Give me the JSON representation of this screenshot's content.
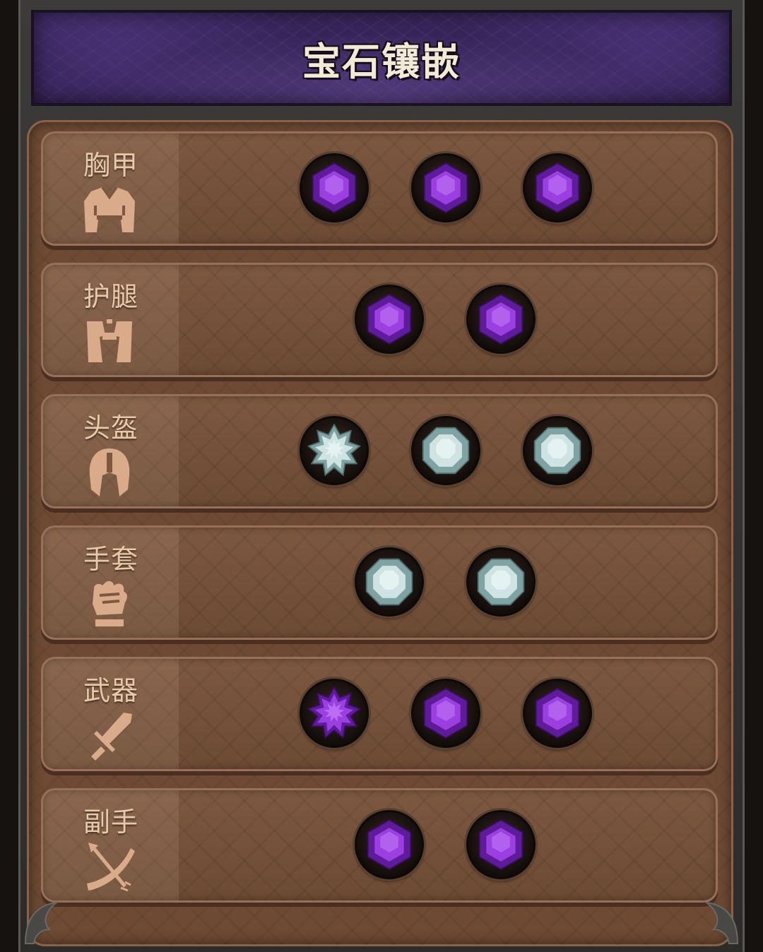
{
  "header": {
    "title": "宝石镶嵌"
  },
  "colors": {
    "purple_gem": "#9b3fe0",
    "silver_gem": "#cfe3e2",
    "label_text": "#e8c9a8",
    "panel_brown": "#6e4a34"
  },
  "slots": [
    {
      "label": "胸甲",
      "icon": "chest-armor-icon",
      "gems": [
        "purple-hexagon",
        "purple-hexagon",
        "purple-hexagon"
      ]
    },
    {
      "label": "护腿",
      "icon": "leg-armor-icon",
      "gems": [
        "purple-hexagon",
        "purple-hexagon"
      ]
    },
    {
      "label": "头盔",
      "icon": "helmet-icon",
      "gems": [
        "silver-star",
        "silver-octagon",
        "silver-octagon"
      ]
    },
    {
      "label": "手套",
      "icon": "glove-fist-icon",
      "gems": [
        "silver-octagon",
        "silver-octagon"
      ]
    },
    {
      "label": "武器",
      "icon": "sword-icon",
      "gems": [
        "purple-star",
        "purple-hexagon",
        "purple-hexagon"
      ]
    },
    {
      "label": "副手",
      "icon": "bow-arrow-icon",
      "gems": [
        "purple-hexagon",
        "purple-hexagon"
      ]
    }
  ]
}
